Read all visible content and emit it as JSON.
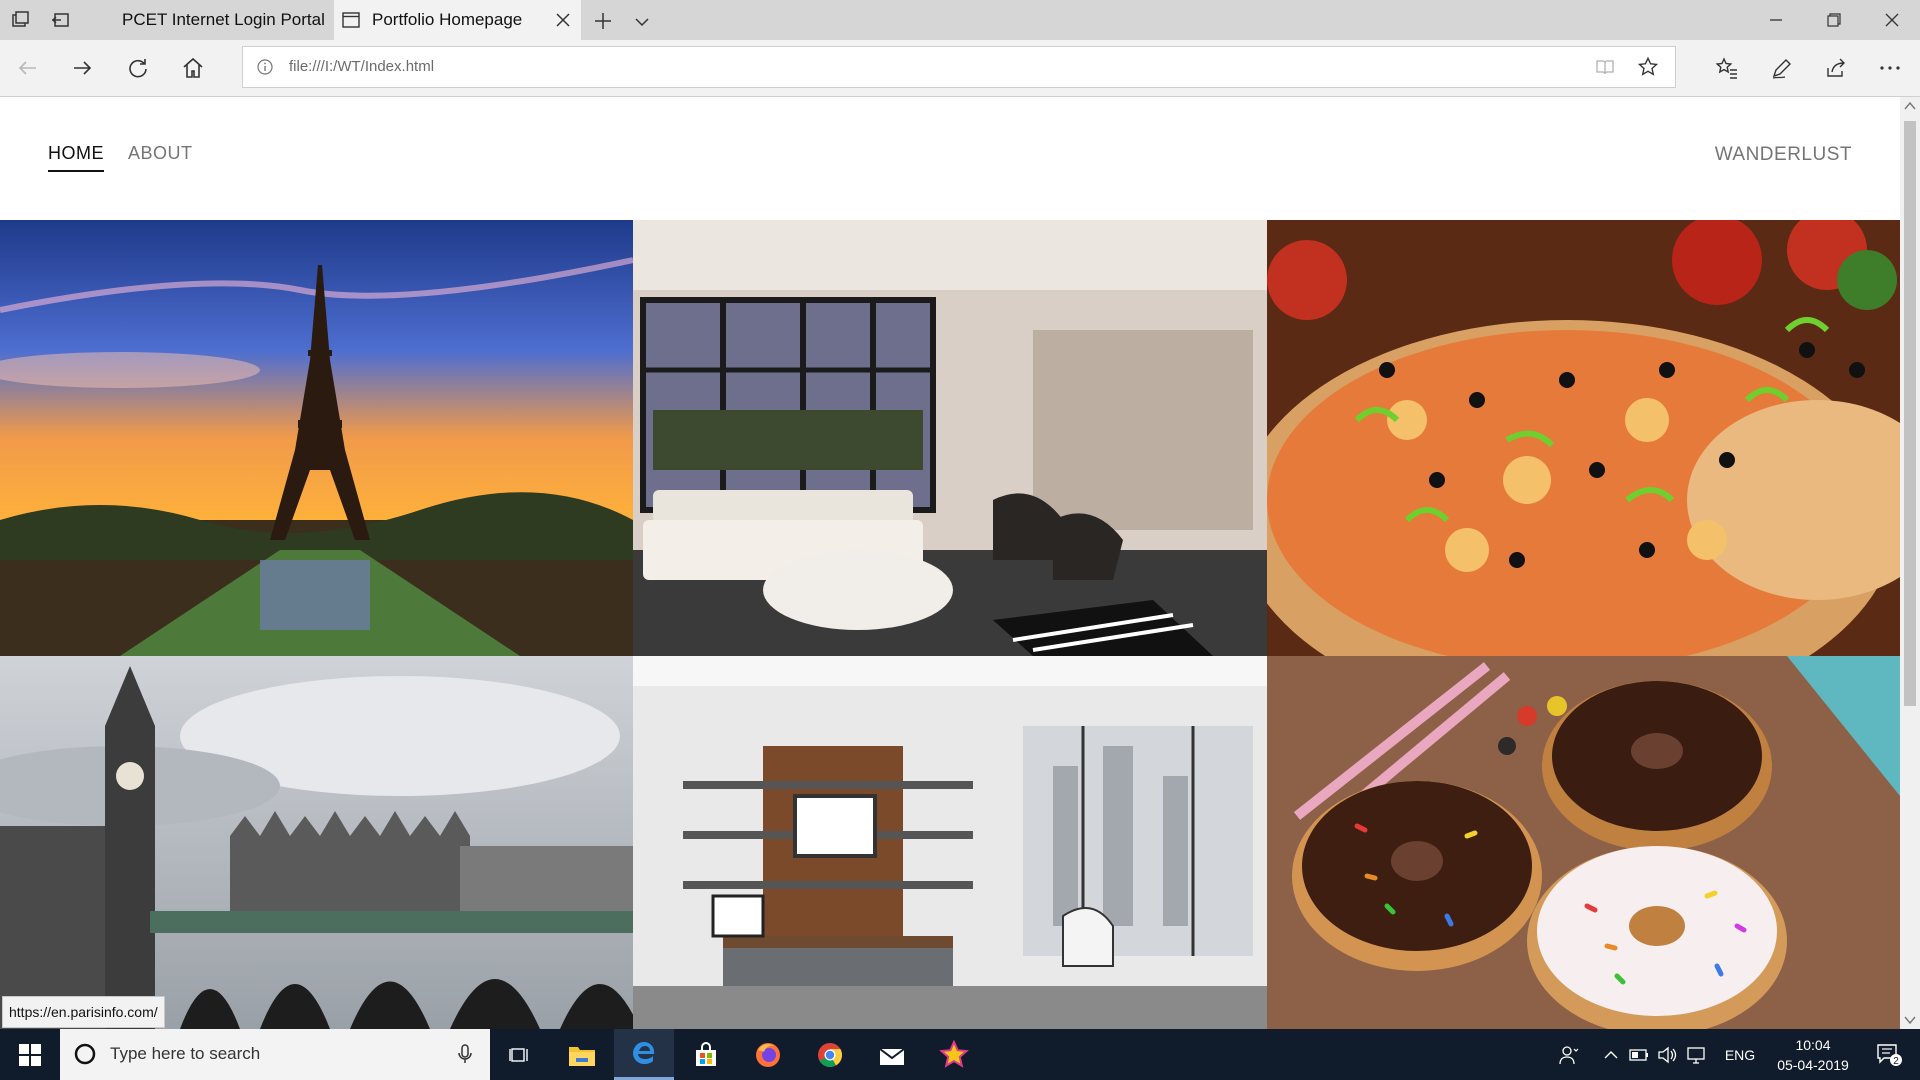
{
  "browser": {
    "tabs": [
      {
        "label": "PCET Internet Login Portal",
        "active": false
      },
      {
        "label": "Portfolio Homepage",
        "active": true
      }
    ],
    "address": "file:///I:/WT/Index.html"
  },
  "site": {
    "nav": [
      {
        "label": "HOME",
        "active": true
      },
      {
        "label": "ABOUT",
        "active": false
      }
    ],
    "brand": "WANDERLUST",
    "gallery": [
      {
        "subject": "eiffel-tower-sunset"
      },
      {
        "subject": "modern-living-room"
      },
      {
        "subject": "pizza"
      },
      {
        "subject": "big-ben-westminster-bridge"
      },
      {
        "subject": "tv-lounge-interior"
      },
      {
        "subject": "donuts"
      }
    ]
  },
  "status_url": "https://en.parisinfo.com/",
  "taskbar": {
    "search_placeholder": "Type here to search",
    "language": "ENG",
    "time": "10:04",
    "date": "05-04-2019",
    "notification_count": "2"
  },
  "colors": {
    "taskbar_bg": "#101c2c",
    "tab_bar_bg": "#d6d6d6",
    "active_tab_bg": "#f2f2f2",
    "nav_active": "#111111",
    "nav_inactive": "#757575"
  }
}
